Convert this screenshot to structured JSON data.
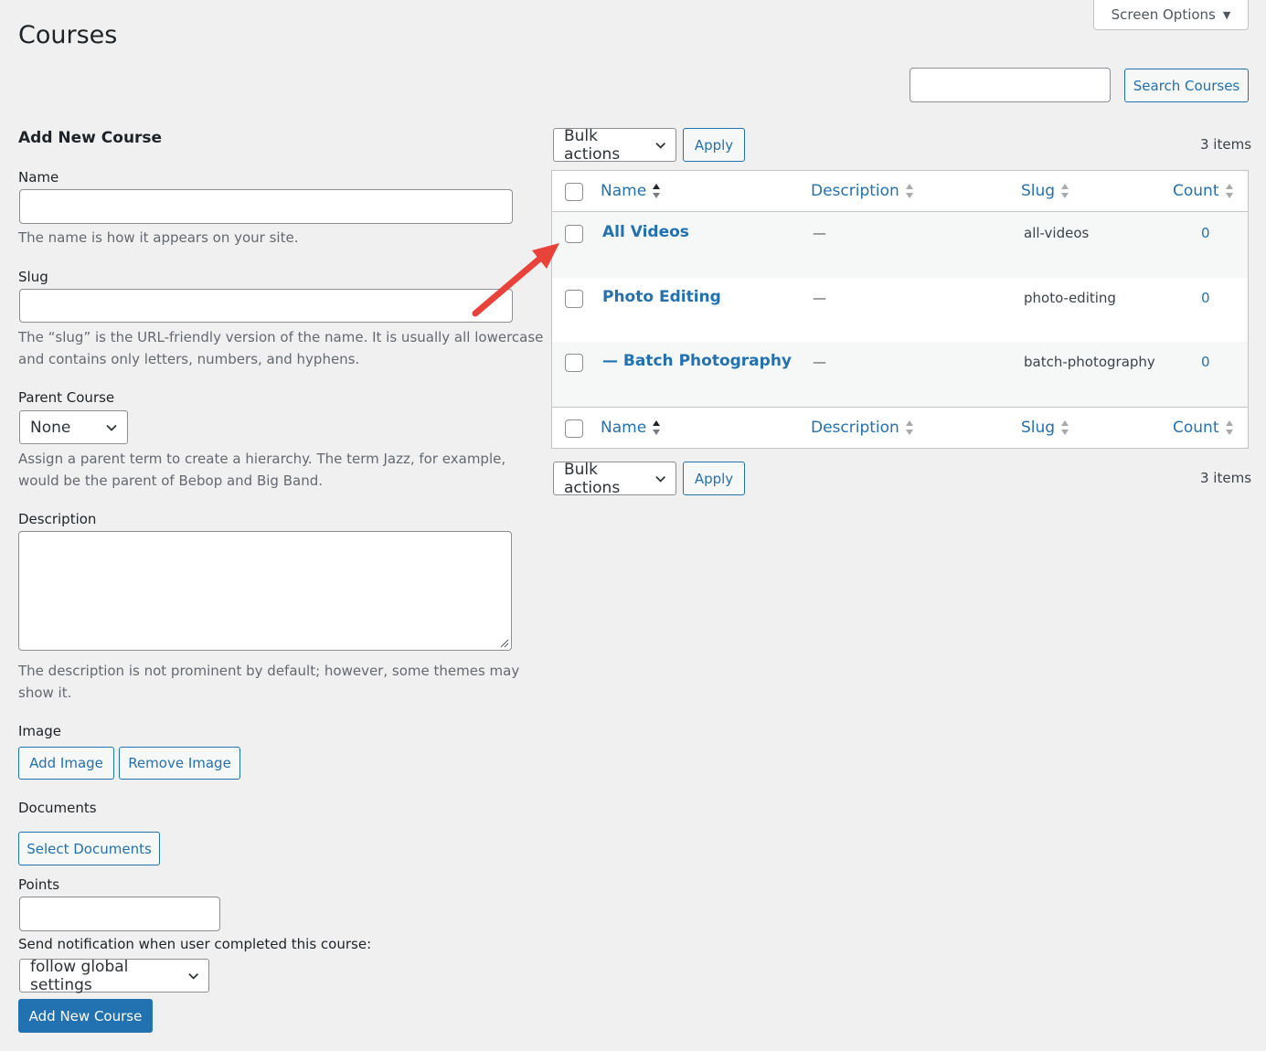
{
  "page": {
    "title": "Courses"
  },
  "screen_options": {
    "label": "Screen Options",
    "icon": "triangle-down-icon"
  },
  "search": {
    "placeholder": "",
    "button_label": "Search Courses"
  },
  "form": {
    "heading": "Add New Course",
    "name": {
      "label": "Name",
      "value": "",
      "help": "The name is how it appears on your site."
    },
    "slug": {
      "label": "Slug",
      "value": "",
      "help_line1": "The “slug” is the URL-friendly version of the name. It is usually all lowercase",
      "help_line2": "and contains only letters, numbers, and hyphens."
    },
    "parent": {
      "label": "Parent Course",
      "selected": "None",
      "help_line1": "Assign a parent term to create a hierarchy. The term Jazz, for example,",
      "help_line2": "would be the parent of Bebop and Big Band."
    },
    "description": {
      "label": "Description",
      "value": "",
      "help_line1": "The description is not prominent by default; however, some themes may",
      "help_line2": "show it."
    },
    "image": {
      "label": "Image",
      "add_label": "Add Image",
      "remove_label": "Remove Image"
    },
    "documents": {
      "label": "Documents",
      "select_label": "Select Documents"
    },
    "points": {
      "label": "Points",
      "value": ""
    },
    "notification": {
      "label": "Send notification when user completed this course:",
      "selected": "follow global settings"
    },
    "submit_label": "Add New Course"
  },
  "table": {
    "bulk_actions_label": "Bulk actions",
    "apply_label": "Apply",
    "items_count": "3 items",
    "columns": {
      "name": "Name",
      "description": "Description",
      "slug": "Slug",
      "count": "Count"
    },
    "rows": [
      {
        "name": "All Videos",
        "description": "—",
        "slug": "all-videos",
        "count": "0"
      },
      {
        "name": "Photo Editing",
        "description": "—",
        "slug": "photo-editing",
        "count": "0"
      },
      {
        "name": "— Batch Photography",
        "description": "—",
        "slug": "batch-photography",
        "count": "0"
      }
    ]
  },
  "colors": {
    "accent": "#2271b1",
    "background": "#f0f0f1",
    "annotation_arrow": "#e8423a"
  }
}
